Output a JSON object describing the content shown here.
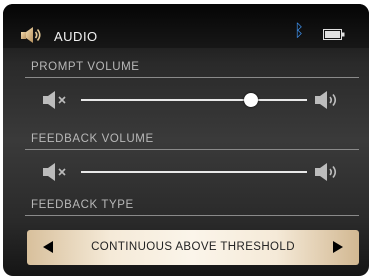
{
  "header": {
    "title": "AUDIO",
    "icon": "speaker-icon",
    "bluetooth_icon": "bluetooth-icon",
    "battery_icon": "battery-icon"
  },
  "prompt_volume": {
    "label": "PROMPT VOLUME",
    "level": 0.75,
    "min_icon": "volume-mute-icon",
    "max_icon": "volume-loud-icon"
  },
  "feedback_volume": {
    "label": "FEEDBACK VOLUME",
    "min_icon": "volume-mute-icon",
    "max_icon": "volume-loud-icon"
  },
  "feedback_type": {
    "label": "FEEDBACK TYPE",
    "value": "CONTINUOUS ABOVE THRESHOLD",
    "prev_icon": "arrow-left-icon",
    "next_icon": "arrow-right-icon"
  },
  "colors": {
    "accent_bluetooth": "#3d8ee8",
    "selector_bg": "#f5ead8"
  }
}
